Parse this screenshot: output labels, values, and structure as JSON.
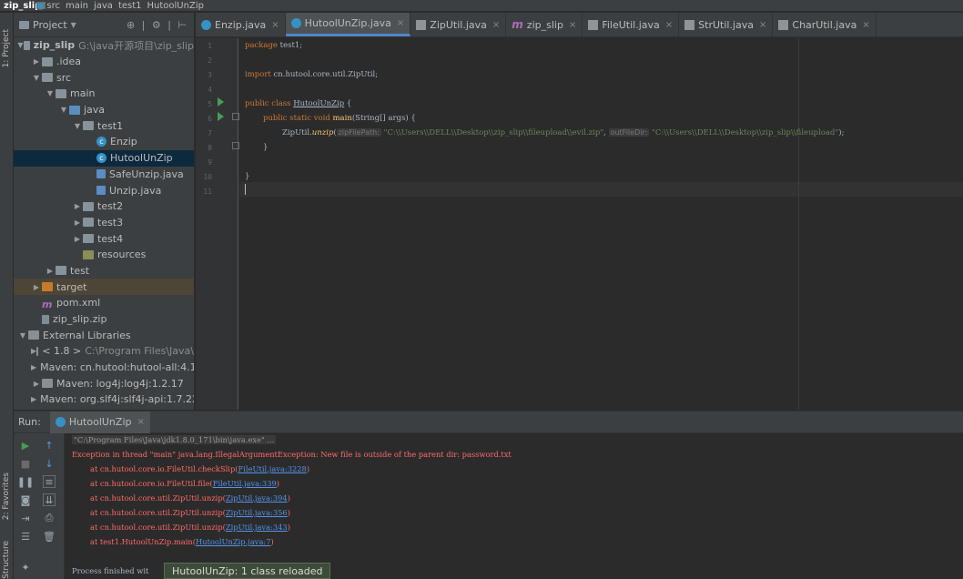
{
  "breadcrumb": [
    {
      "label": "zip_slip",
      "bold": true
    },
    {
      "label": "src"
    },
    {
      "label": "main"
    },
    {
      "label": "java"
    },
    {
      "label": "test1"
    },
    {
      "label": "HutoolUnZip"
    }
  ],
  "left_strip": {
    "project_label": "1: Project",
    "favorites_label": "2: Favorites",
    "structure_label": "Structure"
  },
  "project_panel": {
    "title": "Project",
    "tree": [
      {
        "label": "zip_slip",
        "path": "G:\\java开源项目\\zip_slip",
        "arrow": "▼",
        "icon": "folder",
        "depth": 0,
        "bold": true
      },
      {
        "label": ".idea",
        "arrow": "▶",
        "icon": "folder",
        "depth": 1
      },
      {
        "label": "src",
        "arrow": "▼",
        "icon": "folder",
        "depth": 1
      },
      {
        "label": "main",
        "arrow": "▼",
        "icon": "folder",
        "depth": 2
      },
      {
        "label": "java",
        "arrow": "▼",
        "icon": "srcf",
        "depth": 3
      },
      {
        "label": "test1",
        "arrow": "▼",
        "icon": "pkg",
        "depth": 4
      },
      {
        "label": "Enzip",
        "arrow": "",
        "icon": "cls",
        "depth": 5
      },
      {
        "label": "HutoolUnZip",
        "arrow": "",
        "icon": "cls",
        "depth": 5,
        "selected": true
      },
      {
        "label": "SafeUnzip.java",
        "arrow": "",
        "icon": "java",
        "depth": 5
      },
      {
        "label": "Unzip.java",
        "arrow": "",
        "icon": "java",
        "depth": 5
      },
      {
        "label": "test2",
        "arrow": "▶",
        "icon": "pkg",
        "depth": 4
      },
      {
        "label": "test3",
        "arrow": "▶",
        "icon": "pkg",
        "depth": 4
      },
      {
        "label": "test4",
        "arrow": "▶",
        "icon": "pkg",
        "depth": 4
      },
      {
        "label": "resources",
        "arrow": "",
        "icon": "res",
        "depth": 4
      },
      {
        "label": "test",
        "arrow": "▶",
        "icon": "folder",
        "depth": 2
      },
      {
        "label": "target",
        "arrow": "▶",
        "icon": "orange",
        "depth": 1,
        "highlight": true
      },
      {
        "label": "pom.xml",
        "arrow": "",
        "icon": "maven",
        "depth": 1
      },
      {
        "label": "zip_slip.zip",
        "arrow": "",
        "icon": "zip",
        "depth": 1
      },
      {
        "label": "External Libraries",
        "arrow": "▼",
        "icon": "lib",
        "depth": 0
      },
      {
        "label": "< 1.8 >",
        "path": "C:\\Program Files\\Java\\",
        "arrow": "▶",
        "icon": "lib",
        "depth": 1
      },
      {
        "label": "Maven: cn.hutool:hutool-all:4.1.",
        "arrow": "▶",
        "icon": "lib",
        "depth": 1
      },
      {
        "label": "Maven: log4j:log4j:1.2.17",
        "arrow": "▶",
        "icon": "lib",
        "depth": 1
      },
      {
        "label": "Maven: org.slf4j:slf4j-api:1.7.22",
        "arrow": "▶",
        "icon": "lib",
        "depth": 1
      }
    ]
  },
  "tabs": [
    {
      "label": "Enzip.java",
      "icon": "cls"
    },
    {
      "label": "HutoolUnZip.java",
      "icon": "cls",
      "active": true
    },
    {
      "label": "ZipUtil.java",
      "icon": "file"
    },
    {
      "label": "zip_slip",
      "icon": "maven"
    },
    {
      "label": "FileUtil.java",
      "icon": "file"
    },
    {
      "label": "StrUtil.java",
      "icon": "file"
    },
    {
      "label": "CharUtil.java",
      "icon": "file"
    }
  ],
  "editor": {
    "line_numbers": [
      "1",
      "2",
      "3",
      "4",
      "5",
      "6",
      "7",
      "8",
      "9",
      "10",
      "11"
    ],
    "line1_kw": "package",
    "line1_rest": " test1;",
    "line3_kw": "import",
    "line3_rest": " cn.hutool.core.util.ZipUtil;",
    "line5_kw": "public class",
    "line5_name": "HutoolUnZip",
    "line5_rest": " {",
    "line6_kw": "public static void",
    "line6_fn": "main",
    "line6_rest": "(String[] args) {",
    "line7_pre": "ZipUtil.",
    "line7_fn": "unzip",
    "line7_open": "(",
    "line7_hint1": "zipFilePath:",
    "line7_str1": "\"C:\\\\Users\\\\DELL\\\\Desktop\\\\zip_slip\\\\fileupload\\\\evil.zip\"",
    "line7_comma": ", ",
    "line7_hint2": "outFileDir:",
    "line7_str2": "\"C:\\\\Users\\\\DELL\\\\Desktop\\\\zip_slip\\\\fileupload\"",
    "line7_end": ");",
    "line8": "}",
    "line10": "}"
  },
  "run_panel": {
    "label": "Run:",
    "tab": "HutoolUnZip",
    "console": {
      "cmd": "\"C:\\Program Files\\Java\\jdk1.8.0_171\\bin\\java.exe\" ...",
      "exception": "Exception in thread \"main\" java.lang.IllegalArgumentException: New file is outside of the parent dir: password.txt",
      "trace": [
        {
          "at": "at cn.hutool.core.io.FileUtil.checkSlip(",
          "link": "FileUtil.java:3228",
          "end": ")"
        },
        {
          "at": "at cn.hutool.core.io.FileUtil.file(",
          "link": "FileUtil.java:339",
          "end": ")"
        },
        {
          "at": "at cn.hutool.core.util.ZipUtil.unzip(",
          "link": "ZipUtil.java:394",
          "end": ")"
        },
        {
          "at": "at cn.hutool.core.util.ZipUtil.unzip(",
          "link": "ZipUtil.java:356",
          "end": ")"
        },
        {
          "at": "at cn.hutool.core.util.ZipUtil.unzip(",
          "link": "ZipUtil.java:343",
          "end": ")"
        },
        {
          "at": "at test1.HutoolUnZip.main(",
          "link": "HutoolUnZip.java:7",
          "end": ")"
        }
      ],
      "finished": "Process finished wit"
    },
    "toast": "HutoolUnZip: 1 class reloaded"
  }
}
